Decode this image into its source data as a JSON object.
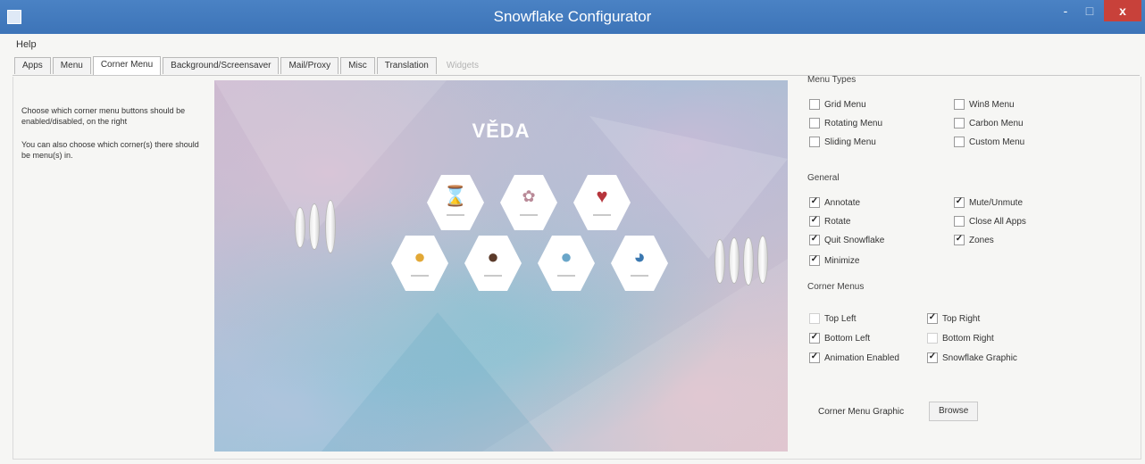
{
  "window": {
    "title": "Snowflake Configurator",
    "close_glyph": "x",
    "min_glyph": "-",
    "max_glyph": "□"
  },
  "menubar": {
    "help": "Help"
  },
  "tabs": [
    {
      "label": "Apps"
    },
    {
      "label": "Menu"
    },
    {
      "label": "Corner Menu",
      "active": true
    },
    {
      "label": "Background/Screensaver"
    },
    {
      "label": "Mail/Proxy"
    },
    {
      "label": "Misc"
    },
    {
      "label": "Translation"
    },
    {
      "label": "Widgets",
      "disabled": true
    }
  ],
  "description": {
    "line1": "Choose which corner menu buttons should be enabled/disabled, on the right",
    "line2": "You can also choose which corner(s) there should be menu(s) in."
  },
  "preview": {
    "title": "VĚDA",
    "hex_icons": [
      "hourglass-icon",
      "microscope-icon",
      "heart-icon",
      "lightbulb-icon",
      "bear-icon",
      "globe-icon",
      "planet-icon"
    ]
  },
  "menu_types": {
    "heading": "Menu Types",
    "items": [
      {
        "label": "Grid Menu",
        "checked": false
      },
      {
        "label": "Rotating Menu",
        "checked": false
      },
      {
        "label": "Sliding Menu",
        "checked": false
      },
      {
        "label": "Win8 Menu",
        "checked": false
      },
      {
        "label": "Carbon Menu",
        "checked": false
      },
      {
        "label": "Custom Menu",
        "checked": false
      }
    ]
  },
  "general": {
    "heading": "General",
    "items": [
      {
        "label": "Annotate",
        "checked": true
      },
      {
        "label": "Rotate",
        "checked": true
      },
      {
        "label": "Quit Snowflake",
        "checked": true
      },
      {
        "label": "Minimize",
        "checked": true
      },
      {
        "label": "Mute/Unmute",
        "checked": true
      },
      {
        "label": "Close All Apps",
        "checked": false
      },
      {
        "label": "Zones",
        "checked": true
      }
    ]
  },
  "corner_menus": {
    "heading": "Corner Menus",
    "items": [
      {
        "label": "Top Left",
        "checked": false
      },
      {
        "label": "Bottom Left",
        "checked": true
      },
      {
        "label": "Animation Enabled",
        "checked": true
      },
      {
        "label": "Top Right",
        "checked": true
      },
      {
        "label": "Bottom Right",
        "checked": false
      },
      {
        "label": "Snowflake Graphic",
        "checked": true
      }
    ]
  },
  "graphic": {
    "label": "Corner Menu Graphic",
    "browse": "Browse"
  },
  "colors": {
    "titlebar": "#3d74b8",
    "close": "#c8413a",
    "accent_text": "#ffffff"
  }
}
